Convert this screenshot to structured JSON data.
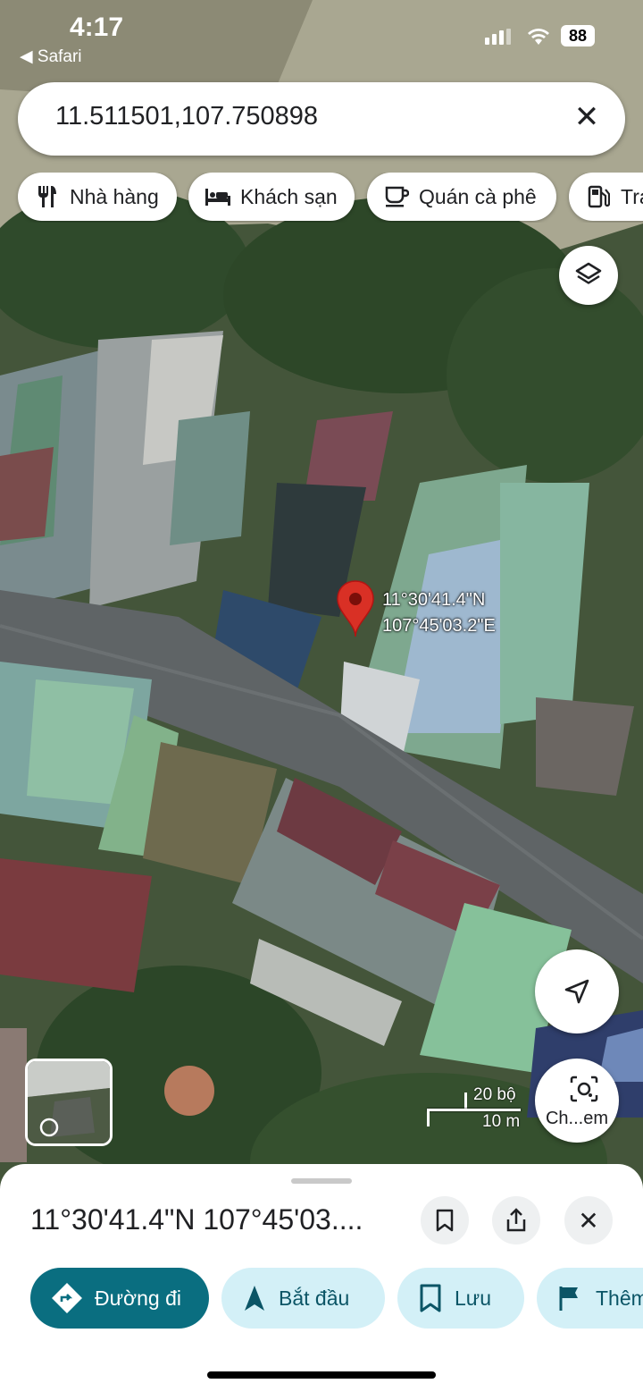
{
  "status_bar": {
    "time": "4:17",
    "back_app": "Safari",
    "battery": "88"
  },
  "search": {
    "query": "11.511501,107.750898",
    "clear_icon": "close-icon"
  },
  "category_chips": [
    {
      "label": "Nhà hàng",
      "icon": "restaurant-icon"
    },
    {
      "label": "Khách sạn",
      "icon": "hotel-icon"
    },
    {
      "label": "Quán cà phê",
      "icon": "coffee-icon"
    },
    {
      "label": "Trạ",
      "icon": "gas-station-icon"
    }
  ],
  "map": {
    "pin_label_lat": "11°30'41.4\"N",
    "pin_label_lng": "107°45'03.2\"E",
    "scale_top": "20 bộ",
    "scale_bottom": "10 m",
    "lens_label": "Ch...em",
    "pin_color": "#d93025"
  },
  "place_sheet": {
    "title": "11°30'41.4\"N 107°45'03....",
    "actions": [
      {
        "label": "Đường đi",
        "icon": "directions-icon"
      },
      {
        "label": "Bắt đầu",
        "icon": "navigation-arrow-icon"
      },
      {
        "label": "Lưu",
        "icon": "bookmark-icon"
      },
      {
        "label": "Thêm",
        "icon": "flag-icon"
      }
    ],
    "accent_color": "#0a6e80",
    "secondary_color": "#d3f0f7"
  }
}
